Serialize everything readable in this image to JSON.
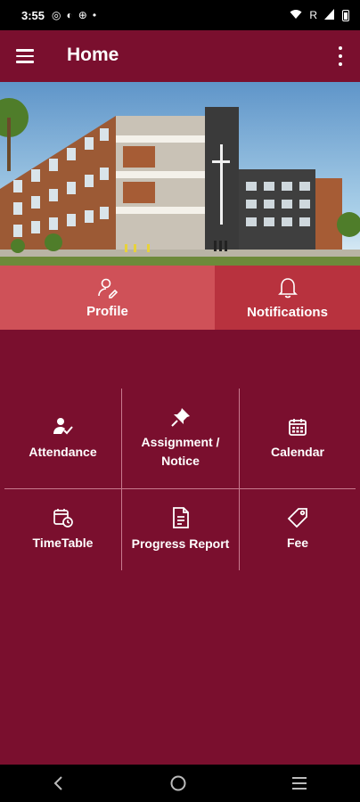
{
  "status_bar": {
    "time": "3:55",
    "signal_label": "R"
  },
  "app_bar": {
    "title": "Home",
    "menu_icon": "menu-icon",
    "more_icon": "more-vert-icon"
  },
  "banner": {
    "alt": "School building illustration"
  },
  "tabs": [
    {
      "label": "Profile",
      "icon": "profile-icon"
    },
    {
      "label": "Notifications",
      "icon": "bell-icon"
    }
  ],
  "grid": [
    {
      "label": "Attendance",
      "icon": "attendance-icon"
    },
    {
      "label": "Assignment / Notice",
      "icon": "pin-icon"
    },
    {
      "label": "Calendar",
      "icon": "calendar-icon"
    },
    {
      "label": "TimeTable",
      "icon": "timetable-icon"
    },
    {
      "label": "Progress Report",
      "icon": "report-icon"
    },
    {
      "label": "Fee",
      "icon": "tag-icon"
    }
  ],
  "colors": {
    "primary": "#7a0f2e",
    "tab_profile": "#cf5158",
    "tab_notifications": "#b8323e",
    "divider": "#c77a8e"
  }
}
